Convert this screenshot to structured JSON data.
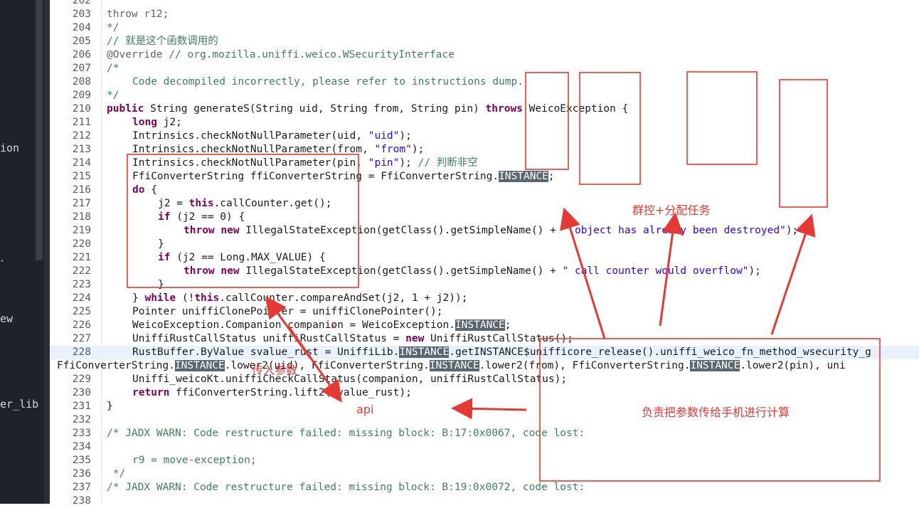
{
  "sidebar": {
    "labels": [
      "ion",
      "ew",
      "er_lib"
    ],
    "marker": "•"
  },
  "code_lines": [
    {
      "num": "202",
      "indent": 0,
      "parts": []
    },
    {
      "num": "203",
      "indent": 1,
      "parts": [
        {
          "t": "kw2",
          "v": "throw r12;"
        }
      ]
    },
    {
      "num": "204",
      "indent": 1,
      "parts": [
        {
          "t": "cm",
          "v": "*/"
        }
      ]
    },
    {
      "num": "205",
      "indent": 1,
      "parts": [
        {
          "t": "cm",
          "v": "// 就是这个函数调用的"
        }
      ]
    },
    {
      "num": "206",
      "indent": 1,
      "parts": [
        {
          "t": "ann",
          "v": "@Override"
        },
        {
          "t": "cm",
          "v": " // org.mozilla.uniffi.weico.WSecurityInterface"
        }
      ]
    },
    {
      "num": "207",
      "indent": 1,
      "parts": [
        {
          "t": "cm",
          "v": "/*"
        }
      ]
    },
    {
      "num": "208",
      "indent": 2,
      "parts": [
        {
          "t": "cm",
          "v": "Code decompiled incorrectly, please refer to instructions dump."
        }
      ]
    },
    {
      "num": "209",
      "indent": 1,
      "parts": [
        {
          "t": "cm",
          "v": "*/"
        }
      ]
    },
    {
      "num": "210",
      "indent": 1,
      "parts": [
        {
          "t": "kw",
          "v": "public"
        },
        {
          "t": "p",
          "v": " String generateS(String uid, String from, String pin) "
        },
        {
          "t": "kw",
          "v": "throws"
        },
        {
          "t": "p",
          "v": " WeicoException {"
        }
      ]
    },
    {
      "num": "211",
      "indent": 2,
      "parts": [
        {
          "t": "kw",
          "v": "long"
        },
        {
          "t": "p",
          "v": " j2;"
        }
      ]
    },
    {
      "num": "212",
      "indent": 2,
      "parts": [
        {
          "t": "p",
          "v": "Intrinsics.checkNotNullParameter(uid, "
        },
        {
          "t": "str",
          "v": "\"uid\""
        },
        {
          "t": "p",
          "v": ");"
        }
      ]
    },
    {
      "num": "213",
      "indent": 2,
      "parts": [
        {
          "t": "p",
          "v": "Intrinsics.checkNotNullParameter(from, "
        },
        {
          "t": "str",
          "v": "\"from\""
        },
        {
          "t": "p",
          "v": ");"
        }
      ]
    },
    {
      "num": "214",
      "indent": 2,
      "parts": [
        {
          "t": "p",
          "v": "Intrinsics.checkNotNullParameter(pin, "
        },
        {
          "t": "str",
          "v": "\"pin\""
        },
        {
          "t": "p",
          "v": "); "
        },
        {
          "t": "cm",
          "v": "// 判断非空"
        }
      ]
    },
    {
      "num": "215",
      "indent": 2,
      "parts": [
        {
          "t": "p",
          "v": "FfiConverterString ffiConverterString = FfiConverterString."
        },
        {
          "t": "inst",
          "v": "INSTANCE"
        },
        {
          "t": "p",
          "v": ";"
        }
      ]
    },
    {
      "num": "216",
      "indent": 2,
      "parts": [
        {
          "t": "kw",
          "v": "do"
        },
        {
          "t": "p",
          "v": " {"
        }
      ]
    },
    {
      "num": "217",
      "indent": 3,
      "parts": [
        {
          "t": "p",
          "v": "j2 = "
        },
        {
          "t": "kw",
          "v": "this"
        },
        {
          "t": "p",
          "v": ".callCounter.get();"
        }
      ]
    },
    {
      "num": "218",
      "indent": 3,
      "parts": [
        {
          "t": "kw",
          "v": "if"
        },
        {
          "t": "p",
          "v": " (j2 == 0) {"
        }
      ]
    },
    {
      "num": "219",
      "indent": 4,
      "parts": [
        {
          "t": "kw",
          "v": "throw new"
        },
        {
          "t": "p",
          "v": " IllegalStateException(getClass().getSimpleName() + "
        },
        {
          "t": "str",
          "v": "\" object has already been destroyed\""
        },
        {
          "t": "p",
          "v": ");"
        }
      ]
    },
    {
      "num": "220",
      "indent": 3,
      "parts": [
        {
          "t": "p",
          "v": "}"
        }
      ]
    },
    {
      "num": "221",
      "indent": 3,
      "parts": [
        {
          "t": "kw",
          "v": "if"
        },
        {
          "t": "p",
          "v": " (j2 == Long.MAX_VALUE) {"
        }
      ]
    },
    {
      "num": "222",
      "indent": 4,
      "parts": [
        {
          "t": "kw",
          "v": "throw new"
        },
        {
          "t": "p",
          "v": " IllegalStateException(getClass().getSimpleName() + "
        },
        {
          "t": "str",
          "v": "\" call counter would overflow\""
        },
        {
          "t": "p",
          "v": ");"
        }
      ]
    },
    {
      "num": "223",
      "indent": 3,
      "parts": [
        {
          "t": "p",
          "v": "}"
        }
      ]
    },
    {
      "num": "224",
      "indent": 2,
      "parts": [
        {
          "t": "p",
          "v": "} "
        },
        {
          "t": "kw",
          "v": "while"
        },
        {
          "t": "p",
          "v": " (!"
        },
        {
          "t": "kw",
          "v": "this"
        },
        {
          "t": "p",
          "v": ".callCounter.compareAndSet(j2, 1 + j2));"
        }
      ]
    },
    {
      "num": "225",
      "indent": 2,
      "parts": [
        {
          "t": "p",
          "v": "Pointer uniffiClonePointer = uniffiClonePointer();"
        }
      ]
    },
    {
      "num": "226",
      "indent": 2,
      "parts": [
        {
          "t": "p",
          "v": "WeicoException.Companion companion = WeicoException."
        },
        {
          "t": "inst",
          "v": "INSTANCE"
        },
        {
          "t": "p",
          "v": ";"
        }
      ]
    },
    {
      "num": "227",
      "indent": 2,
      "parts": [
        {
          "t": "p",
          "v": "UniffiRustCallStatus uniffiRustCallStatus = "
        },
        {
          "t": "kw",
          "v": "new"
        },
        {
          "t": "p",
          "v": " UniffiRustCallStatus();"
        }
      ]
    },
    {
      "num": "228",
      "indent": 2,
      "hl": true,
      "parts": [
        {
          "t": "p",
          "v": "RustBuffer.ByValue svalue_rust = UniffiLib."
        },
        {
          "t": "inst",
          "v": "INSTANCE"
        },
        {
          "t": "p",
          "v": ".getINSTANCE$unifficore_release().uniffi_weico_fn_method_wsecurity_g"
        }
      ]
    },
    {
      "num": "",
      "indent": -1,
      "parts": [
        {
          "t": "p",
          "v": "FfiConverterString."
        },
        {
          "t": "inst",
          "v": "INSTANCE"
        },
        {
          "t": "p",
          "v": ".lower2(uid), FfiConverterString."
        },
        {
          "t": "inst",
          "v": "INSTANCE"
        },
        {
          "t": "p",
          "v": ".lower2(from), FfiConverterString."
        },
        {
          "t": "inst",
          "v": "INSTANCE"
        },
        {
          "t": "p",
          "v": ".lower2(pin), uni"
        }
      ]
    },
    {
      "num": "229",
      "indent": 2,
      "parts": [
        {
          "t": "p",
          "v": "Uniffi_weicoKt.uniffiCheckCallStatus(companion, uniffiRustCallStatus);"
        }
      ]
    },
    {
      "num": "230",
      "indent": 2,
      "parts": [
        {
          "t": "kw",
          "v": "return"
        },
        {
          "t": "p",
          "v": " ffiConverterString.lift2(svalue_rust);"
        }
      ]
    },
    {
      "num": "231",
      "indent": 1,
      "parts": [
        {
          "t": "p",
          "v": "}"
        }
      ]
    },
    {
      "num": "232",
      "indent": 0,
      "parts": []
    },
    {
      "num": "233",
      "indent": 1,
      "parts": [
        {
          "t": "cm",
          "v": "/* JADX WARN: Code restructure failed: missing block: B:17:0x0067, code lost:"
        }
      ]
    },
    {
      "num": "234",
      "indent": 0,
      "parts": []
    },
    {
      "num": "235",
      "indent": 2,
      "parts": [
        {
          "t": "cm",
          "v": "r9 = move-exception;"
        }
      ]
    },
    {
      "num": "236",
      "indent": 1,
      "parts": [
        {
          "t": "cm",
          "v": " */"
        }
      ]
    },
    {
      "num": "237",
      "indent": 1,
      "parts": [
        {
          "t": "cm",
          "v": "/* JADX WARN: Code restructure failed: missing block: B:19:0x0072, code lost:"
        }
      ]
    },
    {
      "num": "238",
      "indent": 0,
      "parts": []
    }
  ],
  "annotations": {
    "group_control": "群控+分配任务",
    "param_in": "传入参数",
    "api": "api",
    "phone_compute": "负责把参数传给手机进行计算",
    "small_s": "s"
  },
  "colors": {
    "annotation": "#e53935",
    "keyword": "#7f0055",
    "comment": "#3f7f5f",
    "string": "#2a00ff"
  }
}
